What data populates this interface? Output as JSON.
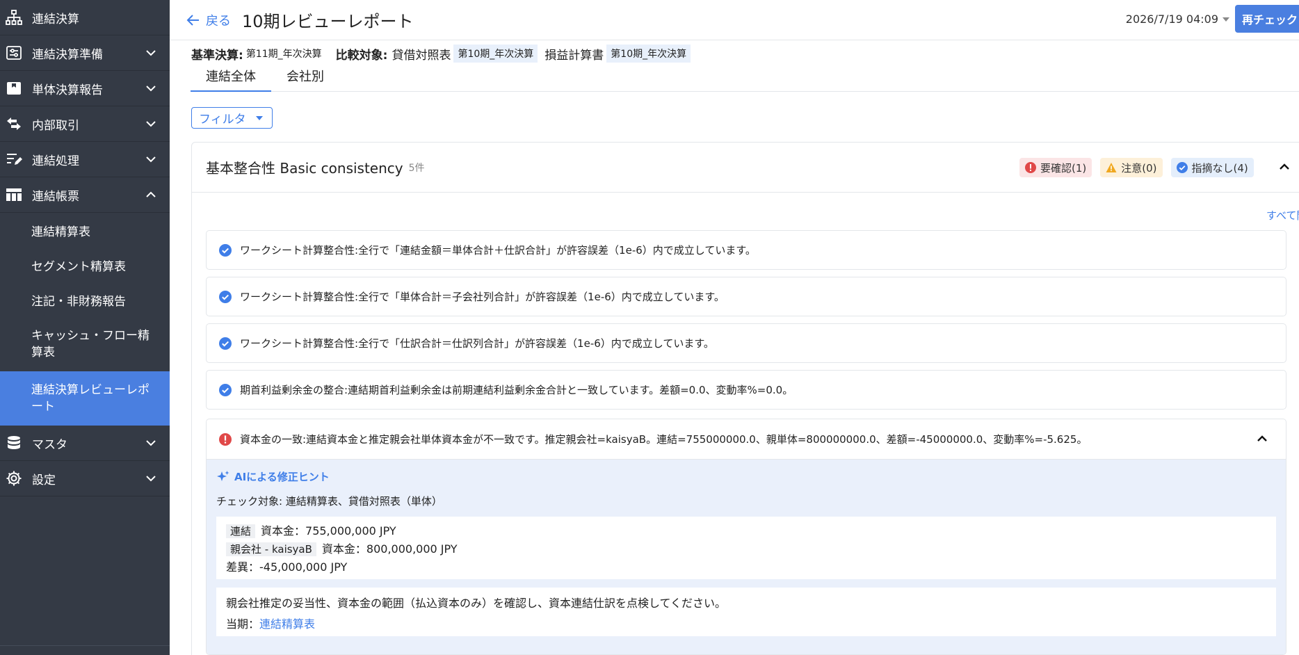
{
  "sidebar": {
    "items": [
      {
        "label": "連結決算",
        "icon": "org-chart-icon"
      },
      {
        "label": "連結決算準備",
        "icon": "sliders-icon"
      },
      {
        "label": "単体決算報告",
        "icon": "inbox-icon"
      },
      {
        "label": "内部取引",
        "icon": "swap-arrows-icon"
      },
      {
        "label": "連結処理",
        "icon": "edit-list-icon"
      },
      {
        "label": "連結帳票",
        "icon": "table-icon"
      },
      {
        "label": "マスタ",
        "icon": "database-icon"
      },
      {
        "label": "設定",
        "icon": "gear-icon"
      }
    ],
    "subitems": [
      {
        "label": "連結精算表"
      },
      {
        "label": "セグメント精算表"
      },
      {
        "label": "注記・非財務報告"
      },
      {
        "label": "キャッシュ・フロー精算表"
      },
      {
        "label": "連結決算レビューレポート"
      }
    ]
  },
  "header": {
    "back_label": "戻る",
    "title": "10期レビューレポート",
    "datetime": "2026/7/19 04:09",
    "recheck_label": "再チェック"
  },
  "criteria": {
    "base_label": "基準決算:",
    "base_value": "第11期_年次決算",
    "compare_label": "比較対象:",
    "bs_label": "貸借対照表",
    "bs_value": "第10期_年次決算",
    "pl_label": "損益計算書",
    "pl_value": "第10期_年次決算"
  },
  "tabs": [
    {
      "label": "連結全体",
      "active": true
    },
    {
      "label": "会社別",
      "active": false
    }
  ],
  "filter_label": "フィルタ",
  "section": {
    "title": "基本整合性 Basic consistency",
    "count": "5件",
    "badges": {
      "error": "要確認(1)",
      "warning": "注意(0)",
      "ok": "指摘なし(4)"
    },
    "open_all": "すべて開く",
    "checks": [
      "ワークシート計算整合性:全行で「連結金額＝単体合計＋仕訳合計」が許容誤差（1e-6）内で成立しています。",
      "ワークシート計算整合性:全行で「単体合計＝子会社列合計」が許容誤差（1e-6）内で成立しています。",
      "ワークシート計算整合性:全行で「仕訳合計＝仕訳列合計」が許容誤差（1e-6）内で成立しています。",
      "期首利益剰余金の整合:連結期首利益剰余金は前期連結利益剰余金合計と一致しています。差額=0.0、変動率%=0.0。"
    ],
    "error": {
      "message": "資本金の一致:連結資本金と推定親会社単体資本金が不一致です。推定親会社=kaisyaB。連結=755000000.0、親単体=800000000.0、差額=-45000000.0、変動率%=-5.625。",
      "hint_title": "AIによる修正ヒント",
      "target": "チェック対象: 連結精算表、貸借対照表（単体）",
      "row1_tag": "連結",
      "row1_text": "資本金：755,000,000 JPY",
      "row2_tag": "親会社 - kaisyaB",
      "row2_text": "資本金：800,000,000 JPY",
      "row3_text": "差異：-45,000,000 JPY",
      "advice": "親会社推定の妥当性、資本金の範囲（払込資本のみ）を確認し、資本連結仕訳を点検してください。",
      "link_prefix": "当期：",
      "link_label": "連結精算表"
    }
  },
  "colors": {
    "sidebar_bg": "#343a45",
    "accent": "#4a7fe0",
    "error": "#e04848",
    "warning": "#f0a81f"
  }
}
